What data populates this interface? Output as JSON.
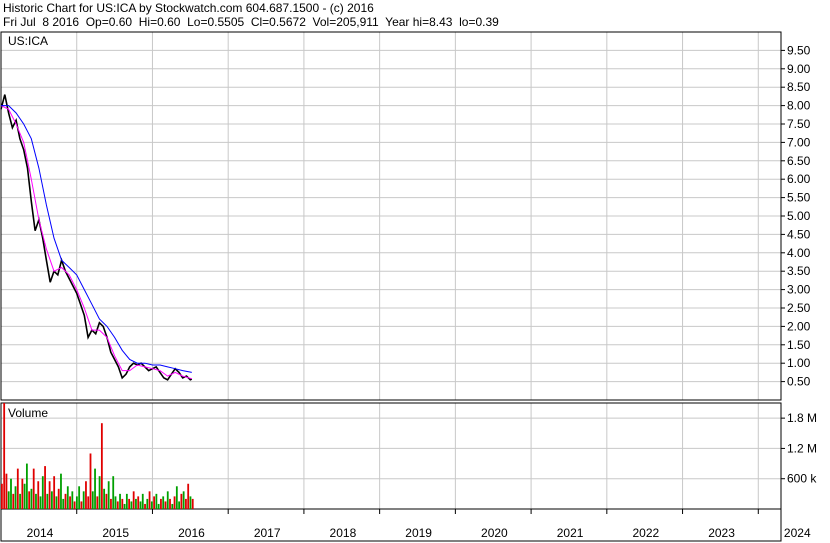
{
  "header": {
    "line1": "Historic Chart for US:ICA by Stockwatch.com 604.687.1500 - (c) 2016",
    "line2": "Fri Jul  8 2016  Op=0.60  Hi=0.60  Lo=0.5505  Cl=0.5672  Vol=205,911  Year hi=8.43  lo=0.39"
  },
  "colors": {
    "background": "#ffffff",
    "grid": "#c8c8c8",
    "axis": "#000000",
    "price_bar": "#000000",
    "ma_short": "#ff00ff",
    "ma_long": "#0000ff",
    "volume_up": "#00a000",
    "volume_down": "#e00000"
  },
  "chart_data": [
    {
      "type": "line",
      "title": "US:ICA",
      "ylim": [
        0,
        10
      ],
      "y_ticks": [
        "9.50",
        "9.00",
        "8.50",
        "8.00",
        "7.50",
        "7.00",
        "6.50",
        "6.00",
        "5.50",
        "5.00",
        "4.50",
        "4.00",
        "3.50",
        "3.00",
        "2.50",
        "2.00",
        "1.50",
        "1.00",
        "0.50"
      ],
      "y_tick_values": [
        9.5,
        9.0,
        8.5,
        8.0,
        7.5,
        7.0,
        6.5,
        6.0,
        5.5,
        5.0,
        4.5,
        4.0,
        3.5,
        3.0,
        2.5,
        2.0,
        1.5,
        1.0,
        0.5
      ],
      "x_ticks": [
        "2014",
        "2015",
        "2016",
        "2017",
        "2018",
        "2019",
        "2020",
        "2021",
        "2022",
        "2023",
        "2024"
      ],
      "x_range": [
        2014.0,
        2024.3
      ],
      "grid": true,
      "series": [
        {
          "role": "price",
          "x": [
            2014.0,
            2014.05,
            2014.1,
            2014.15,
            2014.2,
            2014.25,
            2014.3,
            2014.35,
            2014.4,
            2014.45,
            2014.5,
            2014.55,
            2014.6,
            2014.65,
            2014.7,
            2014.75,
            2014.8,
            2014.85,
            2014.9,
            2014.95,
            2015.0,
            2015.05,
            2015.1,
            2015.15,
            2015.2,
            2015.25,
            2015.3,
            2015.35,
            2015.4,
            2015.45,
            2015.5,
            2015.55,
            2015.6,
            2015.65,
            2015.7,
            2015.75,
            2015.8,
            2015.85,
            2015.9,
            2015.95,
            2016.0,
            2016.05,
            2016.1,
            2016.15,
            2016.2,
            2016.25,
            2016.3,
            2016.35,
            2016.4,
            2016.45,
            2016.5,
            2016.52
          ],
          "y": [
            7.9,
            8.3,
            7.8,
            7.4,
            7.6,
            7.1,
            6.8,
            6.3,
            5.4,
            4.6,
            4.9,
            4.4,
            3.8,
            3.2,
            3.5,
            3.4,
            3.8,
            3.5,
            3.3,
            3.1,
            2.9,
            2.6,
            2.3,
            1.7,
            1.9,
            1.8,
            2.1,
            2.0,
            1.7,
            1.3,
            1.1,
            0.9,
            0.6,
            0.7,
            0.9,
            1.0,
            0.95,
            1.0,
            0.9,
            0.8,
            0.85,
            0.9,
            0.75,
            0.6,
            0.55,
            0.7,
            0.85,
            0.75,
            0.6,
            0.65,
            0.55,
            0.57
          ]
        },
        {
          "role": "ma_short",
          "x": [
            2014.0,
            2014.1,
            2014.2,
            2014.3,
            2014.4,
            2014.5,
            2014.6,
            2014.7,
            2014.8,
            2014.9,
            2015.0,
            2015.1,
            2015.2,
            2015.3,
            2015.4,
            2015.5,
            2015.6,
            2015.7,
            2015.8,
            2015.9,
            2016.0,
            2016.1,
            2016.2,
            2016.3,
            2016.4,
            2016.52
          ],
          "y": [
            8.0,
            7.9,
            7.5,
            7.0,
            6.0,
            4.9,
            4.1,
            3.5,
            3.6,
            3.4,
            3.0,
            2.5,
            1.9,
            1.9,
            1.7,
            1.2,
            0.8,
            0.8,
            0.95,
            0.9,
            0.85,
            0.8,
            0.65,
            0.75,
            0.65,
            0.58
          ]
        },
        {
          "role": "ma_long",
          "x": [
            2014.0,
            2014.1,
            2014.2,
            2014.3,
            2014.4,
            2014.5,
            2014.6,
            2014.7,
            2014.8,
            2014.9,
            2015.0,
            2015.1,
            2015.2,
            2015.3,
            2015.4,
            2015.5,
            2015.6,
            2015.7,
            2015.8,
            2015.9,
            2016.0,
            2016.1,
            2016.2,
            2016.3,
            2016.4,
            2016.52
          ],
          "y": [
            8.0,
            8.0,
            7.8,
            7.5,
            7.1,
            6.3,
            5.3,
            4.4,
            3.8,
            3.6,
            3.4,
            3.0,
            2.6,
            2.2,
            2.0,
            1.7,
            1.35,
            1.1,
            1.0,
            1.0,
            0.95,
            0.95,
            0.9,
            0.85,
            0.8,
            0.75
          ]
        }
      ]
    },
    {
      "type": "bar",
      "title": "Volume",
      "ylim": [
        0,
        2100000
      ],
      "y_ticks": [
        "1.8 M",
        "1.2 M",
        "600 k"
      ],
      "y_tick_values": [
        1800000,
        1200000,
        600000
      ],
      "x_range": [
        2014.0,
        2024.3
      ],
      "grid": true,
      "x": [
        2014.0,
        2014.03,
        2014.06,
        2014.09,
        2014.12,
        2014.15,
        2014.18,
        2014.21,
        2014.24,
        2014.27,
        2014.3,
        2014.33,
        2014.36,
        2014.39,
        2014.42,
        2014.45,
        2014.48,
        2014.51,
        2014.54,
        2014.57,
        2014.6,
        2014.63,
        2014.66,
        2014.69,
        2014.72,
        2014.75,
        2014.78,
        2014.81,
        2014.84,
        2014.87,
        2014.9,
        2014.93,
        2014.96,
        2014.99,
        2015.02,
        2015.05,
        2015.08,
        2015.11,
        2015.14,
        2015.17,
        2015.2,
        2015.23,
        2015.26,
        2015.29,
        2015.32,
        2015.35,
        2015.38,
        2015.41,
        2015.44,
        2015.47,
        2015.5,
        2015.53,
        2015.56,
        2015.59,
        2015.62,
        2015.65,
        2015.68,
        2015.71,
        2015.74,
        2015.77,
        2015.8,
        2015.83,
        2015.86,
        2015.89,
        2015.92,
        2015.95,
        2015.98,
        2016.01,
        2016.04,
        2016.07,
        2016.1,
        2016.13,
        2016.16,
        2016.19,
        2016.22,
        2016.25,
        2016.28,
        2016.31,
        2016.34,
        2016.37,
        2016.4,
        2016.43,
        2016.46,
        2016.49,
        2016.52
      ],
      "values": [
        500000,
        2100000,
        700000,
        350000,
        600000,
        300000,
        450000,
        800000,
        300000,
        600000,
        500000,
        900000,
        350000,
        400000,
        800000,
        300000,
        550000,
        250000,
        650000,
        850000,
        300000,
        550000,
        350000,
        650000,
        250000,
        400000,
        700000,
        200000,
        300000,
        450000,
        250000,
        350000,
        150000,
        250000,
        450000,
        150000,
        350000,
        550000,
        250000,
        1100000,
        350000,
        800000,
        250000,
        650000,
        1700000,
        400000,
        300000,
        550000,
        200000,
        650000,
        250000,
        150000,
        300000,
        200000,
        100000,
        300000,
        200000,
        150000,
        350000,
        200000,
        250000,
        150000,
        300000,
        100000,
        200000,
        350000,
        150000,
        250000,
        300000,
        100000,
        200000,
        250000,
        150000,
        350000,
        200000,
        100000,
        250000,
        450000,
        150000,
        300000,
        350000,
        200000,
        500000,
        250000,
        200000
      ],
      "direction": [
        "d",
        "d",
        "d",
        "u",
        "u",
        "d",
        "u",
        "d",
        "u",
        "d",
        "u",
        "u",
        "d",
        "u",
        "d",
        "u",
        "d",
        "u",
        "u",
        "d",
        "u",
        "d",
        "u",
        "d",
        "u",
        "d",
        "u",
        "u",
        "d",
        "u",
        "d",
        "u",
        "d",
        "u",
        "u",
        "d",
        "u",
        "d",
        "d",
        "d",
        "u",
        "u",
        "d",
        "u",
        "d",
        "u",
        "d",
        "u",
        "d",
        "u",
        "u",
        "d",
        "u",
        "d",
        "u",
        "u",
        "d",
        "u",
        "d",
        "u",
        "d",
        "u",
        "u",
        "d",
        "u",
        "d",
        "u",
        "d",
        "u",
        "u",
        "d",
        "u",
        "d",
        "u",
        "d",
        "u",
        "d",
        "u",
        "u",
        "d",
        "u",
        "d",
        "d",
        "u",
        "d"
      ]
    }
  ]
}
